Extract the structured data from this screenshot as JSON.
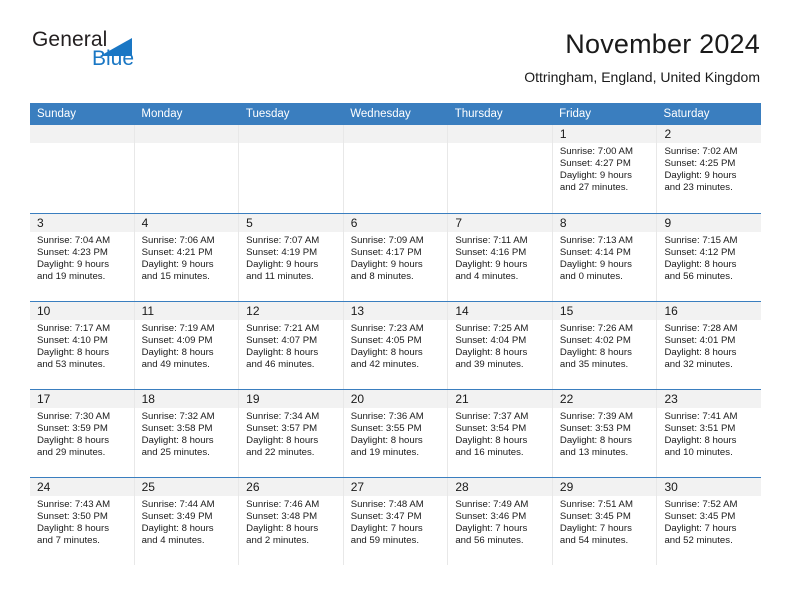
{
  "brand": {
    "name_part1": "General",
    "name_part2": "Blue",
    "logo_icon": "triangle-logo-icon",
    "accent_color": "#1a77c4"
  },
  "header": {
    "title": "November 2024",
    "subtitle": "Ottringham, England, United Kingdom"
  },
  "theme": {
    "header_blue": "#3a7ebf",
    "daynum_band": "#f2f2f2",
    "cell_divider": "#e8e8e8"
  },
  "weekdays": [
    "Sunday",
    "Monday",
    "Tuesday",
    "Wednesday",
    "Thursday",
    "Friday",
    "Saturday"
  ],
  "weeks": [
    [
      {
        "day": "",
        "lines": []
      },
      {
        "day": "",
        "lines": []
      },
      {
        "day": "",
        "lines": []
      },
      {
        "day": "",
        "lines": []
      },
      {
        "day": "",
        "lines": []
      },
      {
        "day": "1",
        "lines": [
          "Sunrise: 7:00 AM",
          "Sunset: 4:27 PM",
          "Daylight: 9 hours",
          "and 27 minutes."
        ]
      },
      {
        "day": "2",
        "lines": [
          "Sunrise: 7:02 AM",
          "Sunset: 4:25 PM",
          "Daylight: 9 hours",
          "and 23 minutes."
        ]
      }
    ],
    [
      {
        "day": "3",
        "lines": [
          "Sunrise: 7:04 AM",
          "Sunset: 4:23 PM",
          "Daylight: 9 hours",
          "and 19 minutes."
        ]
      },
      {
        "day": "4",
        "lines": [
          "Sunrise: 7:06 AM",
          "Sunset: 4:21 PM",
          "Daylight: 9 hours",
          "and 15 minutes."
        ]
      },
      {
        "day": "5",
        "lines": [
          "Sunrise: 7:07 AM",
          "Sunset: 4:19 PM",
          "Daylight: 9 hours",
          "and 11 minutes."
        ]
      },
      {
        "day": "6",
        "lines": [
          "Sunrise: 7:09 AM",
          "Sunset: 4:17 PM",
          "Daylight: 9 hours",
          "and 8 minutes."
        ]
      },
      {
        "day": "7",
        "lines": [
          "Sunrise: 7:11 AM",
          "Sunset: 4:16 PM",
          "Daylight: 9 hours",
          "and 4 minutes."
        ]
      },
      {
        "day": "8",
        "lines": [
          "Sunrise: 7:13 AM",
          "Sunset: 4:14 PM",
          "Daylight: 9 hours",
          "and 0 minutes."
        ]
      },
      {
        "day": "9",
        "lines": [
          "Sunrise: 7:15 AM",
          "Sunset: 4:12 PM",
          "Daylight: 8 hours",
          "and 56 minutes."
        ]
      }
    ],
    [
      {
        "day": "10",
        "lines": [
          "Sunrise: 7:17 AM",
          "Sunset: 4:10 PM",
          "Daylight: 8 hours",
          "and 53 minutes."
        ]
      },
      {
        "day": "11",
        "lines": [
          "Sunrise: 7:19 AM",
          "Sunset: 4:09 PM",
          "Daylight: 8 hours",
          "and 49 minutes."
        ]
      },
      {
        "day": "12",
        "lines": [
          "Sunrise: 7:21 AM",
          "Sunset: 4:07 PM",
          "Daylight: 8 hours",
          "and 46 minutes."
        ]
      },
      {
        "day": "13",
        "lines": [
          "Sunrise: 7:23 AM",
          "Sunset: 4:05 PM",
          "Daylight: 8 hours",
          "and 42 minutes."
        ]
      },
      {
        "day": "14",
        "lines": [
          "Sunrise: 7:25 AM",
          "Sunset: 4:04 PM",
          "Daylight: 8 hours",
          "and 39 minutes."
        ]
      },
      {
        "day": "15",
        "lines": [
          "Sunrise: 7:26 AM",
          "Sunset: 4:02 PM",
          "Daylight: 8 hours",
          "and 35 minutes."
        ]
      },
      {
        "day": "16",
        "lines": [
          "Sunrise: 7:28 AM",
          "Sunset: 4:01 PM",
          "Daylight: 8 hours",
          "and 32 minutes."
        ]
      }
    ],
    [
      {
        "day": "17",
        "lines": [
          "Sunrise: 7:30 AM",
          "Sunset: 3:59 PM",
          "Daylight: 8 hours",
          "and 29 minutes."
        ]
      },
      {
        "day": "18",
        "lines": [
          "Sunrise: 7:32 AM",
          "Sunset: 3:58 PM",
          "Daylight: 8 hours",
          "and 25 minutes."
        ]
      },
      {
        "day": "19",
        "lines": [
          "Sunrise: 7:34 AM",
          "Sunset: 3:57 PM",
          "Daylight: 8 hours",
          "and 22 minutes."
        ]
      },
      {
        "day": "20",
        "lines": [
          "Sunrise: 7:36 AM",
          "Sunset: 3:55 PM",
          "Daylight: 8 hours",
          "and 19 minutes."
        ]
      },
      {
        "day": "21",
        "lines": [
          "Sunrise: 7:37 AM",
          "Sunset: 3:54 PM",
          "Daylight: 8 hours",
          "and 16 minutes."
        ]
      },
      {
        "day": "22",
        "lines": [
          "Sunrise: 7:39 AM",
          "Sunset: 3:53 PM",
          "Daylight: 8 hours",
          "and 13 minutes."
        ]
      },
      {
        "day": "23",
        "lines": [
          "Sunrise: 7:41 AM",
          "Sunset: 3:51 PM",
          "Daylight: 8 hours",
          "and 10 minutes."
        ]
      }
    ],
    [
      {
        "day": "24",
        "lines": [
          "Sunrise: 7:43 AM",
          "Sunset: 3:50 PM",
          "Daylight: 8 hours",
          "and 7 minutes."
        ]
      },
      {
        "day": "25",
        "lines": [
          "Sunrise: 7:44 AM",
          "Sunset: 3:49 PM",
          "Daylight: 8 hours",
          "and 4 minutes."
        ]
      },
      {
        "day": "26",
        "lines": [
          "Sunrise: 7:46 AM",
          "Sunset: 3:48 PM",
          "Daylight: 8 hours",
          "and 2 minutes."
        ]
      },
      {
        "day": "27",
        "lines": [
          "Sunrise: 7:48 AM",
          "Sunset: 3:47 PM",
          "Daylight: 7 hours",
          "and 59 minutes."
        ]
      },
      {
        "day": "28",
        "lines": [
          "Sunrise: 7:49 AM",
          "Sunset: 3:46 PM",
          "Daylight: 7 hours",
          "and 56 minutes."
        ]
      },
      {
        "day": "29",
        "lines": [
          "Sunrise: 7:51 AM",
          "Sunset: 3:45 PM",
          "Daylight: 7 hours",
          "and 54 minutes."
        ]
      },
      {
        "day": "30",
        "lines": [
          "Sunrise: 7:52 AM",
          "Sunset: 3:45 PM",
          "Daylight: 7 hours",
          "and 52 minutes."
        ]
      }
    ]
  ]
}
